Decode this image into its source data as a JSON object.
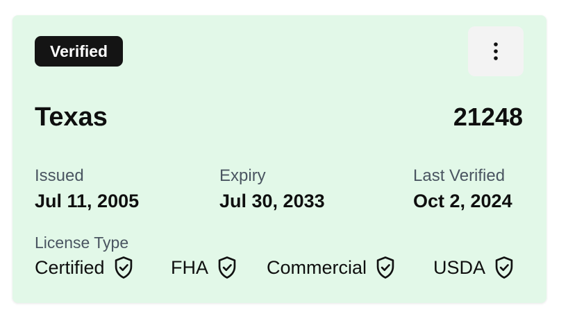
{
  "badge": {
    "label": "Verified"
  },
  "menu": {
    "icon": "more-vertical-icon"
  },
  "license": {
    "state": "Texas",
    "number": "21248"
  },
  "dates": {
    "issued_label": "Issued",
    "issued_value": "Jul 11, 2005",
    "expiry_label": "Expiry",
    "expiry_value": "Jul 30, 2033",
    "verified_label": "Last Verified",
    "verified_value": "Oct 2, 2024"
  },
  "license_types": {
    "label": "License Type",
    "icon": "shield-check-icon",
    "items": [
      {
        "label": "Certified"
      },
      {
        "label": "FHA"
      },
      {
        "label": "Commercial"
      },
      {
        "label": "USDA"
      }
    ]
  },
  "colors": {
    "card_background": "#e2f8e8",
    "badge_background": "#141414",
    "menu_button_background": "#f3f3f3",
    "muted_text": "#4a5561"
  }
}
